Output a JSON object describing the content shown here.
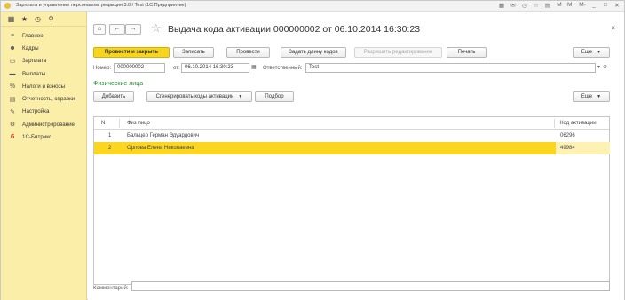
{
  "window": {
    "title": "Зарплата и управление персоналом, редакция 3.0 / Test  (1С:Предприятие)",
    "icons": [
      "▦",
      "✉",
      "◷",
      "☆",
      "▤",
      "M",
      "M+",
      "M-",
      "_",
      "□",
      "✕"
    ]
  },
  "sidebar": {
    "top_icons": [
      "▦",
      "★",
      "◷",
      "⚲"
    ],
    "items": [
      {
        "icon": "≡",
        "label": "Главное"
      },
      {
        "icon": "☻",
        "label": "Кадры"
      },
      {
        "icon": "▭",
        "label": "Зарплата"
      },
      {
        "icon": "▬",
        "label": "Выплаты"
      },
      {
        "icon": "%",
        "label": "Налоги и взносы"
      },
      {
        "icon": "▤",
        "label": "Отчетность, справки"
      },
      {
        "icon": "✎",
        "label": "Настройка"
      },
      {
        "icon": "⚙",
        "label": "Администрирование"
      },
      {
        "icon": "б",
        "label": "1С-Битрикс"
      }
    ]
  },
  "header": {
    "home_icon": "⌂",
    "back_icon": "←",
    "forward_icon": "→",
    "favorite_icon": "☆",
    "title": "Выдача кода активации 000000002 от 06.10.2014 16:30:23",
    "close_icon": "×"
  },
  "toolbar": {
    "post_and_close": "Провести и закрыть",
    "save": "Записать",
    "post": "Провести",
    "set_code_length": "Задать длину кодов",
    "allow_edit": "Разрешить редактирование",
    "print": "Печать",
    "more": "Еще"
  },
  "fields": {
    "number_label": "Номер:",
    "number_value": "000000002",
    "date_label": "от:",
    "date_value": "06.10.2014 16:30:23",
    "responsible_label": "Ответственный:",
    "responsible_value": "Test"
  },
  "group": {
    "title": "Физические лица",
    "add": "Добавить",
    "generate": "Сгенерировать коды активации",
    "pick": "Подбор",
    "more": "Еще"
  },
  "table": {
    "columns": [
      "N",
      "Физ лицо",
      "Код активации"
    ],
    "rows": [
      {
        "n": "1",
        "person": "Бальцер Герман Эдуардович",
        "code": "06296"
      },
      {
        "n": "2",
        "person": "Орлова Елена Николаевна",
        "code": "49984"
      }
    ]
  },
  "comment": {
    "label": "Комментарий:",
    "value": ""
  },
  "colors": {
    "sidebar_bg": "#fbeea8",
    "primary_button": "#f8d51d",
    "selected_row": "#fbd51f",
    "group_title": "#2e8b3a"
  }
}
